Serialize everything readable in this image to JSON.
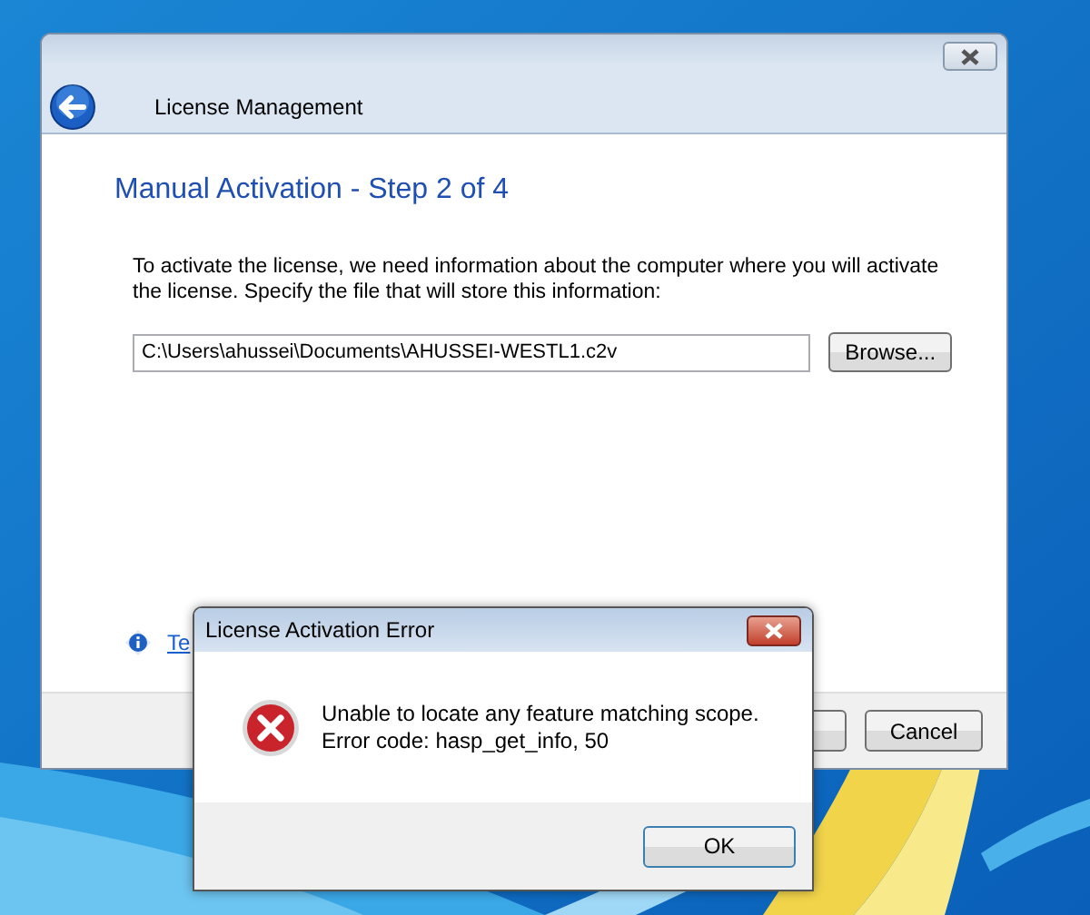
{
  "wizard": {
    "title": "License Management",
    "heading": "Manual Activation - Step 2 of 4",
    "instructions": "To activate the license, we need information about the computer where you will activate the license. Specify the file that will store this information:",
    "file_field": {
      "value": "C:\\Users\\ahussei\\Documents\\AHUSSEI-WESTL1.c2v"
    },
    "browse_button": "Browse...",
    "link": "Te",
    "cancel_button": "Cancel"
  },
  "error_dialog": {
    "title": "License Activation Error",
    "message_lines": [
      "Unable to locate any feature matching scope.",
      "Error code: hasp_get_info, 50"
    ],
    "button": "OK"
  }
}
